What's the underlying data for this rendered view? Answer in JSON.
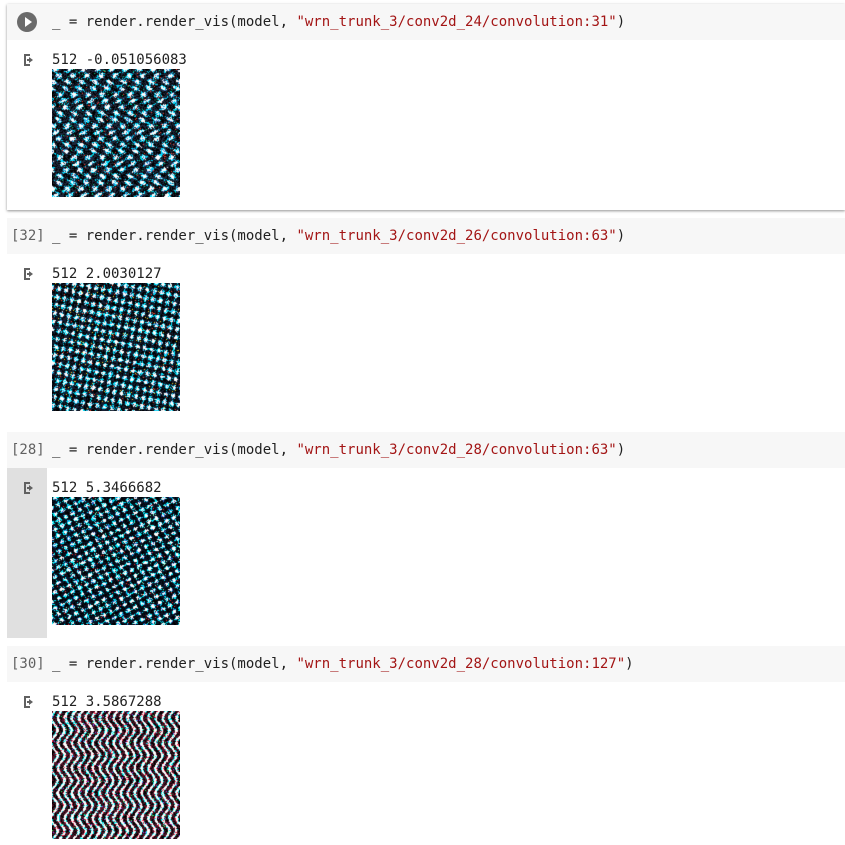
{
  "cells": [
    {
      "exec_count": "",
      "code_prefix": "_ = render.render_vis(model, ",
      "code_string": "\"wrn_trunk_3/conv2d_24/convolution:31\"",
      "code_suffix": ")",
      "output_text": "512 -0.051056083",
      "image_palette": "wave"
    },
    {
      "exec_count": "[32]",
      "code_prefix": "_ = render.render_vis(model, ",
      "code_string": "\"wrn_trunk_3/conv2d_26/convolution:63\"",
      "code_suffix": ")",
      "output_text": "512 2.0030127",
      "image_palette": "mesh"
    },
    {
      "exec_count": "[28]",
      "code_prefix": "_ = render.render_vis(model, ",
      "code_string": "\"wrn_trunk_3/conv2d_28/convolution:63\"",
      "code_suffix": ")",
      "output_text": "512 5.3466682",
      "image_palette": "scale"
    },
    {
      "exec_count": "[30]",
      "code_prefix": "_ = render.render_vis(model, ",
      "code_string": "\"wrn_trunk_3/conv2d_28/convolution:127\"",
      "code_suffix": ")",
      "output_text": "512 3.5867288",
      "image_palette": "stripe"
    }
  ],
  "colors": {
    "string": "#a31515",
    "code_bg": "#f7f7f7",
    "gutter_hover": "#e0e0e0",
    "run_button": "#6b6b6b"
  },
  "icons": {
    "run": "play-circle-icon",
    "output": "output-arrow-icon"
  }
}
